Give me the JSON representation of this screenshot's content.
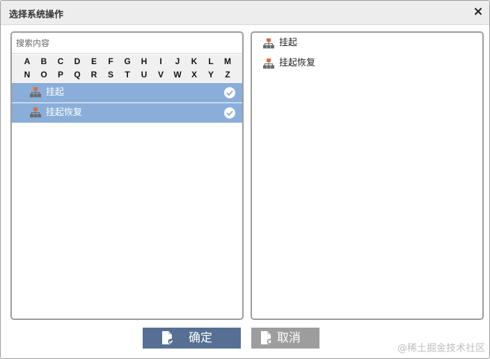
{
  "dialog": {
    "title": "选择系统操作",
    "close_glyph": "×"
  },
  "left_panel": {
    "search_placeholder": "搜索内容",
    "alphabet_row1": [
      "A",
      "B",
      "C",
      "D",
      "E",
      "F",
      "G",
      "H",
      "I",
      "J",
      "K",
      "L",
      "M"
    ],
    "alphabet_row2": [
      "N",
      "O",
      "P",
      "Q",
      "R",
      "S",
      "T",
      "U",
      "V",
      "W",
      "X",
      "Y",
      "Z"
    ],
    "items": [
      {
        "label": "挂起",
        "icon": "org-chart-icon",
        "selected": true
      },
      {
        "label": "挂起恢复",
        "icon": "org-chart-icon",
        "selected": true
      }
    ]
  },
  "right_panel": {
    "items": [
      {
        "label": "挂起",
        "icon": "org-chart-icon"
      },
      {
        "label": "挂起恢复",
        "icon": "org-chart-icon"
      }
    ]
  },
  "buttons": {
    "ok_label": "确定",
    "cancel_label": "取消"
  },
  "watermark": "@稀土掘金技术社区",
  "colors": {
    "selected_bg": "#8aaed9",
    "ok_bg": "#566f93",
    "cancel_bg": "#9d9d9d",
    "org_icon": "#d9703a"
  }
}
